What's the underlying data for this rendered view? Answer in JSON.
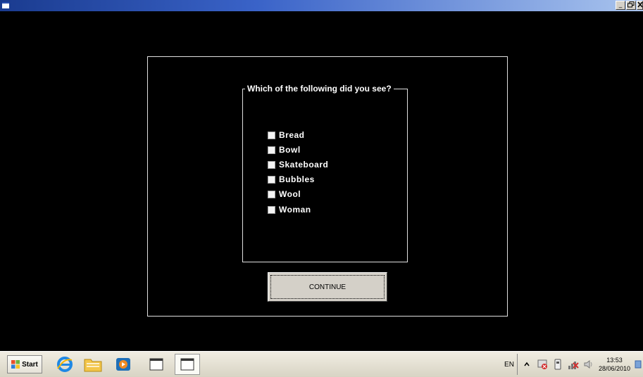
{
  "titlebar": {
    "app_icon": "window-icon",
    "buttons": [
      "_",
      "У",
      "×"
    ]
  },
  "form": {
    "question": "Which of the following did you see?",
    "options": [
      {
        "label": "Bread",
        "checked": false
      },
      {
        "label": "Bowl",
        "checked": false
      },
      {
        "label": "Skateboard",
        "checked": false
      },
      {
        "label": "Bubbles",
        "checked": false
      },
      {
        "label": "Wool",
        "checked": false
      },
      {
        "label": "Woman",
        "checked": false
      }
    ],
    "continue_label": "CONTINUE"
  },
  "taskbar": {
    "start_label": "Start",
    "pinned": [
      "internet-explorer-icon",
      "folder-icon",
      "media-player-icon",
      "app-window-icon",
      "app-window-icon-active"
    ],
    "language": "EN",
    "tray_icons": [
      "show-hidden-icons-icon",
      "action-center-icon",
      "device-icon",
      "network-error-icon",
      "volume-icon"
    ],
    "clock_time": "13:53",
    "clock_date": "28/06/2010"
  },
  "colors": {
    "background": "#000000",
    "frame_border": "#e0e0e0",
    "button_face": "#d4d0c8",
    "titlebar_start": "#1a3b8f",
    "titlebar_end": "#a9c4ee"
  }
}
